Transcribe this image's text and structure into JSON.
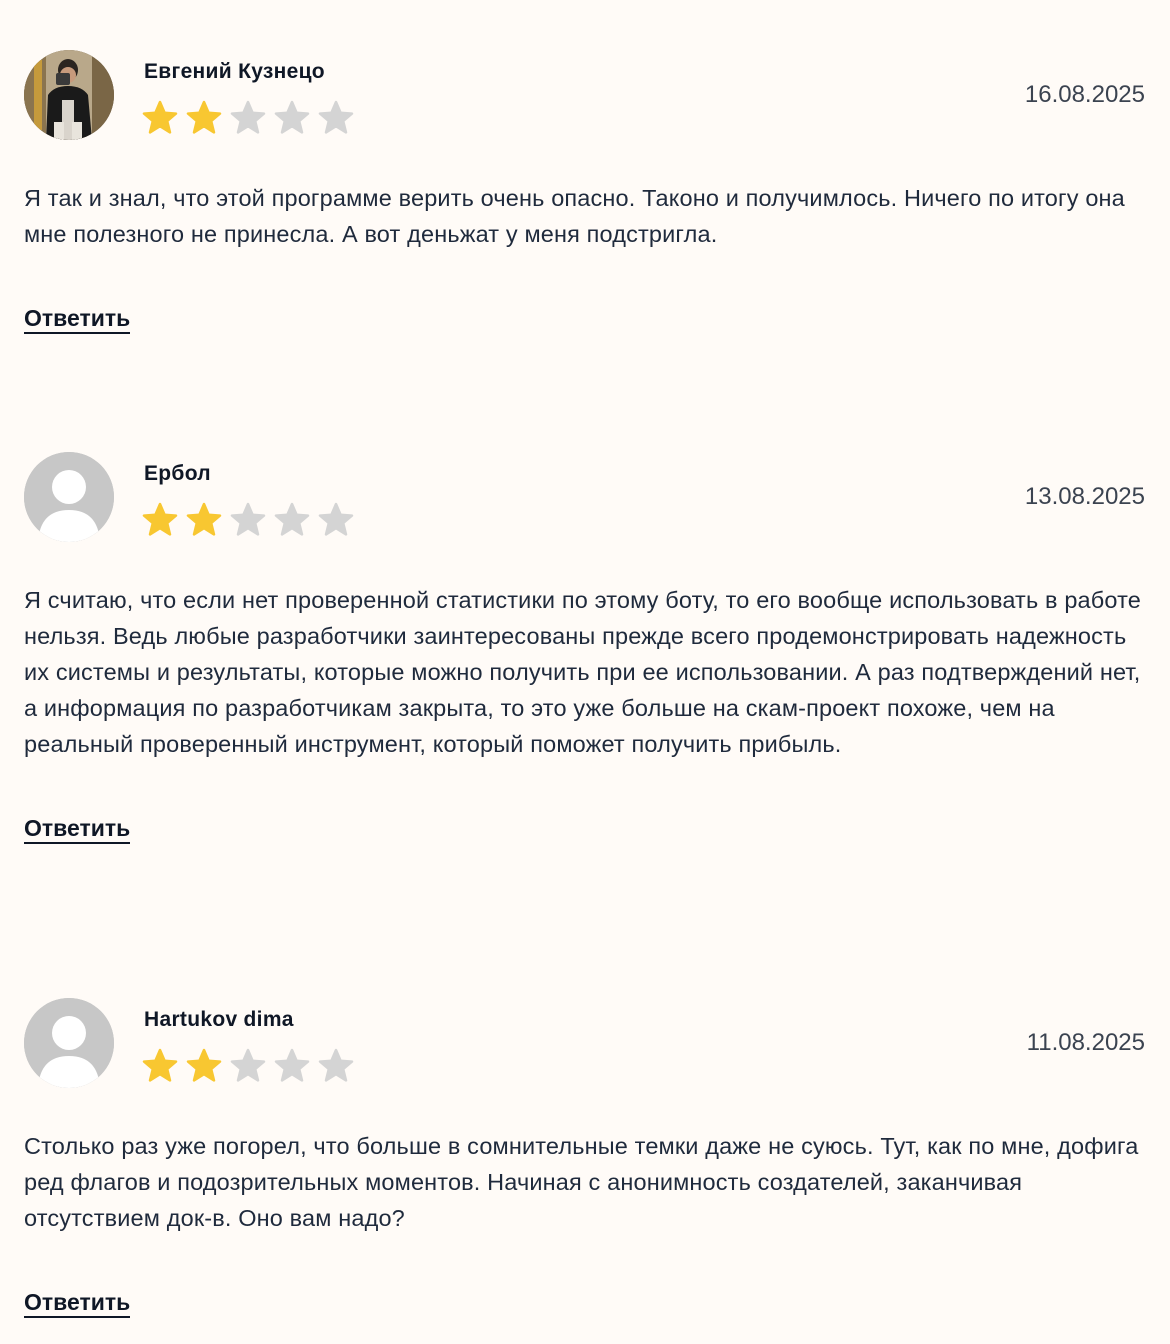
{
  "colors": {
    "background": "#fffbf7",
    "star_filled": "#f8c731",
    "star_empty": "#d4d4d4",
    "text": "#1f2a3c",
    "avatar_placeholder": "#c7c7c7"
  },
  "reviews": [
    {
      "author": "Евгений Кузнецо",
      "date": "16.08.2025",
      "rating": 2,
      "max_rating": 5,
      "avatar": "user-photo",
      "text": "Я так и знал, что этой программе верить очень опасно. Таконо и получимлось. Ничего по итогу она мне полезного не принесла. А вот деньжат у меня подстригла.",
      "reply_label": "Ответить"
    },
    {
      "author": "Ербол",
      "date": "13.08.2025",
      "rating": 2,
      "max_rating": 5,
      "avatar": "default-user-icon",
      "text": "Я считаю, что если нет проверенной статистики по этому боту, то его вообще использовать в работе нельзя. Ведь любые разработчики заинтересованы прежде всего продемонстрировать надежность их системы и результаты, которые можно получить при ее использовании. А раз подтверждений нет, а информация по разработчикам закрыта, то это уже больше на скам-проект похоже, чем на реальный проверенный инструмент, который поможет получить прибыль.",
      "reply_label": "Ответить"
    },
    {
      "author": "Hartukov dima",
      "date": "11.08.2025",
      "rating": 2,
      "max_rating": 5,
      "avatar": "default-user-icon",
      "text": "Столько раз уже погорел, что больше в сомнительные темки даже не суюсь. Тут, как по мне, дофига ред флагов и подозрительных моментов. Начиная с анонимность создателей, заканчивая отсутствием док-в. Оно вам надо?",
      "reply_label": "Ответить"
    }
  ]
}
